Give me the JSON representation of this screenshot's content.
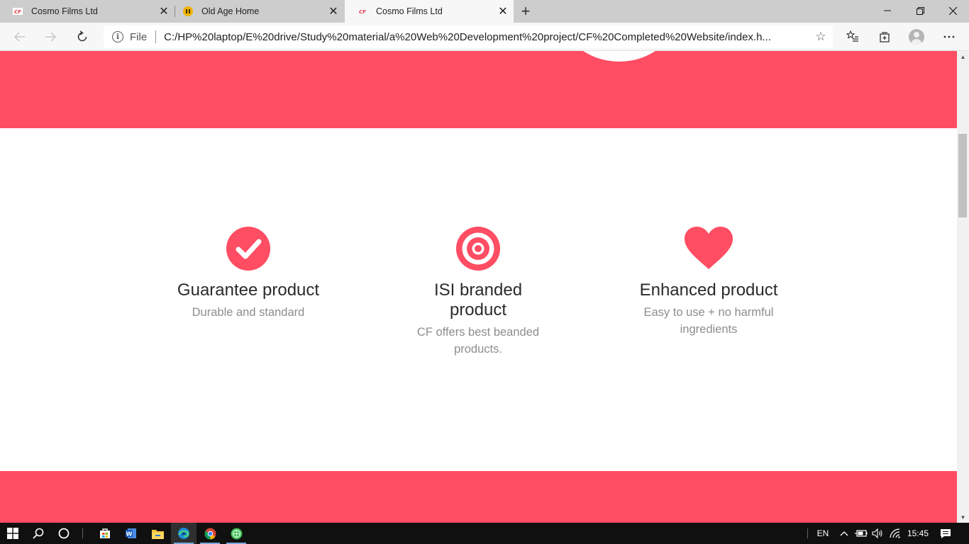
{
  "browser": {
    "tabs": [
      {
        "title": "Cosmo Films Ltd",
        "favicon": "cf-logo-icon",
        "active": false
      },
      {
        "title": "Old Age Home",
        "favicon": "old-age-home-icon",
        "active": false
      },
      {
        "title": "Cosmo Films Ltd",
        "favicon": "cf-logo-icon",
        "active": true
      }
    ],
    "address": {
      "scheme_label": "File",
      "url": "C:/HP%20laptop/E%20drive/Study%20material/a%20Web%20Development%20project/CF%20Completed%20Website/index.h..."
    },
    "favicon_text": "CF"
  },
  "page": {
    "accent_color": "#ff4d63",
    "features": [
      {
        "icon": "check-circle-icon",
        "title": "Guarantee product",
        "description": "Durable and standard"
      },
      {
        "icon": "target-icon",
        "title": "ISI branded product",
        "description": "CF offers best beanded products."
      },
      {
        "icon": "heart-icon",
        "title": "Enhanced product",
        "description": "Easy to use + no harmful ingredients"
      }
    ]
  },
  "taskbar": {
    "apps": [
      "windows-start-icon",
      "search-icon",
      "cortana-icon",
      "store-icon",
      "word-icon",
      "file-explorer-icon",
      "edge-icon",
      "chrome-icon",
      "app-icon"
    ],
    "language": "EN",
    "time": "15:45"
  }
}
